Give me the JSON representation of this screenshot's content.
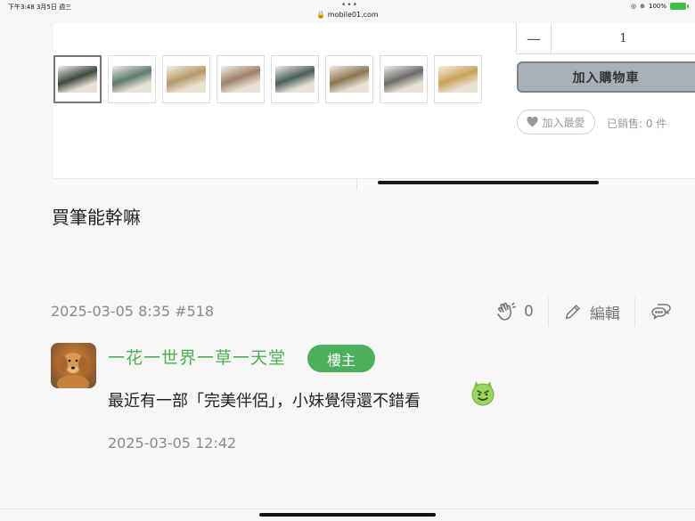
{
  "status_bar": {
    "time_date": "下午3:48  3月5日 週三",
    "url": "mobile01.com",
    "battery": "100%"
  },
  "product": {
    "quantity": "1",
    "add_to_cart": "加入購物車",
    "favorite": "加入最愛",
    "sold": "已銷售: 0 件",
    "thumbnail_colors": [
      "#3b4a3f",
      "#5d7a6c",
      "#b59a6a",
      "#a0806a",
      "#4a5f58",
      "#8a7550",
      "#6b6b6b",
      "#c9a25a"
    ]
  },
  "post": {
    "text": "買筆能幹嘛",
    "meta": "2025-03-05 8:35 #518",
    "like_count": "0",
    "edit_label": "編輯"
  },
  "reply": {
    "username": "一花一世界一草一天堂",
    "badge": "樓主",
    "text": "最近有一部「完美伴侶」，小妹覺得還不錯看",
    "time": "2025-03-05 12:42"
  },
  "colors": {
    "accent_green": "#4caf50",
    "button_gray": "#aab0b8"
  }
}
